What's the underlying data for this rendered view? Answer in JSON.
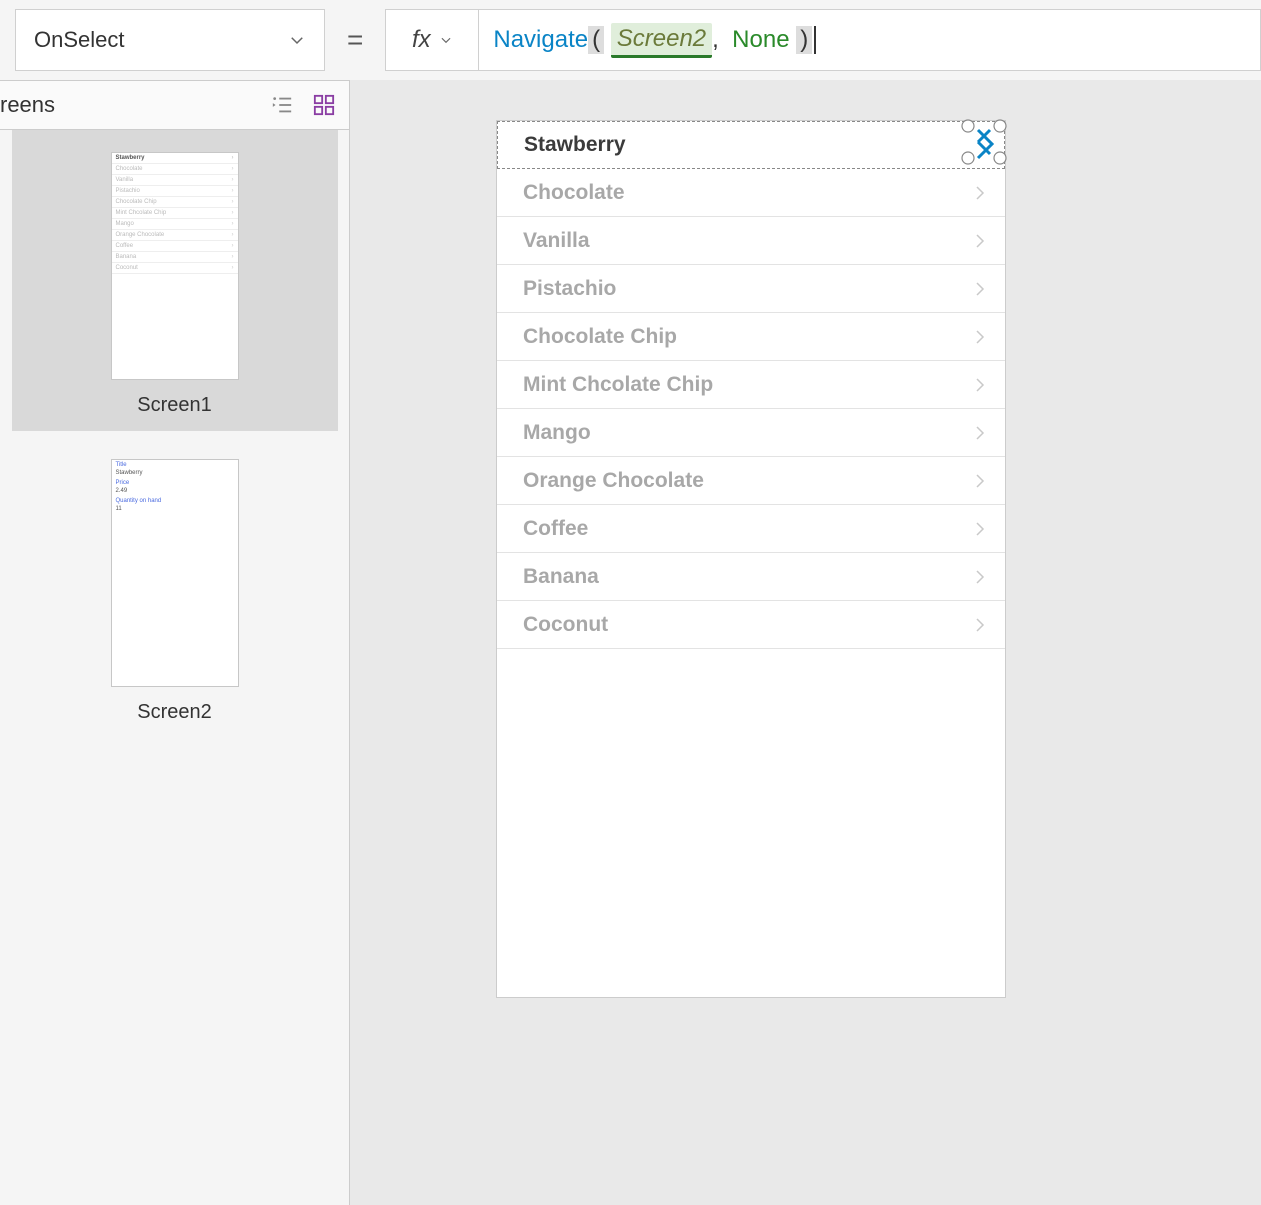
{
  "property": "OnSelect",
  "equals": "=",
  "fx": "fx",
  "formula": {
    "fn": "Navigate",
    "arg": "Screen2",
    "comma": ",",
    "none": "None"
  },
  "panel": {
    "title": "reens",
    "screens": [
      {
        "label": "Screen1"
      },
      {
        "label": "Screen2"
      }
    ]
  },
  "detail": {
    "title_label": "Title",
    "title_value": "Stawberry",
    "price_label": "Price",
    "price_value": "2.49",
    "qty_label": "Quantity on hand",
    "qty_value": "11"
  },
  "gallery": [
    "Stawberry",
    "Chocolate",
    "Vanilla",
    "Pistachio",
    "Chocolate Chip",
    "Mint Chcolate Chip",
    "Mango",
    "Orange Chocolate",
    "Coffee",
    "Banana",
    "Coconut"
  ]
}
